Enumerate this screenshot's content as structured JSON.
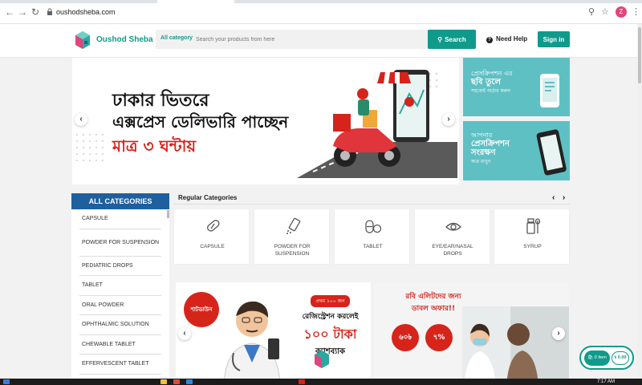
{
  "browser": {
    "url": "oushodsheba.com",
    "profile_initial": "Z"
  },
  "header": {
    "brand": "Oushod Sheba",
    "category_label": "All category",
    "search_placeholder": "Search your products from here",
    "search_button": "Search",
    "need_help": "Need Help",
    "sign_in": "Sign in"
  },
  "hero": {
    "line1": "ঢাকার ভিতরে",
    "line2": "এক্সপ্রেস ডেলিভারি পাচ্ছেন",
    "line3": "মাত্র ৩ ঘন্টায়"
  },
  "side_banners": [
    {
      "text1": "প্রেসক্রিপশন এর",
      "text2": "ছবি তুলে",
      "text3": "সহজেই অর্ডার করুন"
    },
    {
      "text1": "আপনার",
      "text2": "প্রেসক্রিপশন",
      "text3": "সংরক্ষণ",
      "text4": "করে রাখুন"
    }
  ],
  "sidebar": {
    "title": "ALL CATEGORIES",
    "items": [
      "CAPSULE",
      "POWDER FOR SUSPENSION",
      "PEDIATRIC DROPS",
      "TABLET",
      "ORAL POWDER",
      "OPHTHALMIC SOLUTION",
      "CHEWABLE TABLET",
      "EFFERVESCENT TABLET"
    ]
  },
  "regular_categories": {
    "title": "Regular Categories",
    "items": [
      {
        "label": "CAPSULE",
        "icon": "capsule-icon"
      },
      {
        "label": "POWDER FOR SUSPENSION",
        "icon": "powder-icon"
      },
      {
        "label": "TABLET",
        "icon": "tablet-icon"
      },
      {
        "label": "EYE/EAR/NASAL DROPS",
        "icon": "eye-icon"
      },
      {
        "label": "SYRUP",
        "icon": "syrup-icon"
      }
    ]
  },
  "promos": {
    "left": {
      "badge": "শাটডাউন অফার",
      "line1": "প্রথম ১০০ জন",
      "line2": "রেজিস্ট্রেশন করলেই",
      "line3": "১০০ টাকা",
      "line4": "ক্যাশব্যাক"
    },
    "right": {
      "line1": "রবি এলিটদের জন্য",
      "line2": "ডাবল অফার!!",
      "badge1": "৬০৳",
      "badge2": "৭%"
    }
  },
  "cart": {
    "items": "0 Item",
    "amount": "৳ 0.00"
  },
  "taskbar": {
    "clock": "7:17 AM"
  },
  "colors": {
    "brand": "#0f9a8c",
    "sidebar_head": "#1f5f9e",
    "accent_red": "#d6241b",
    "side_banner": "#5fc0c4"
  }
}
